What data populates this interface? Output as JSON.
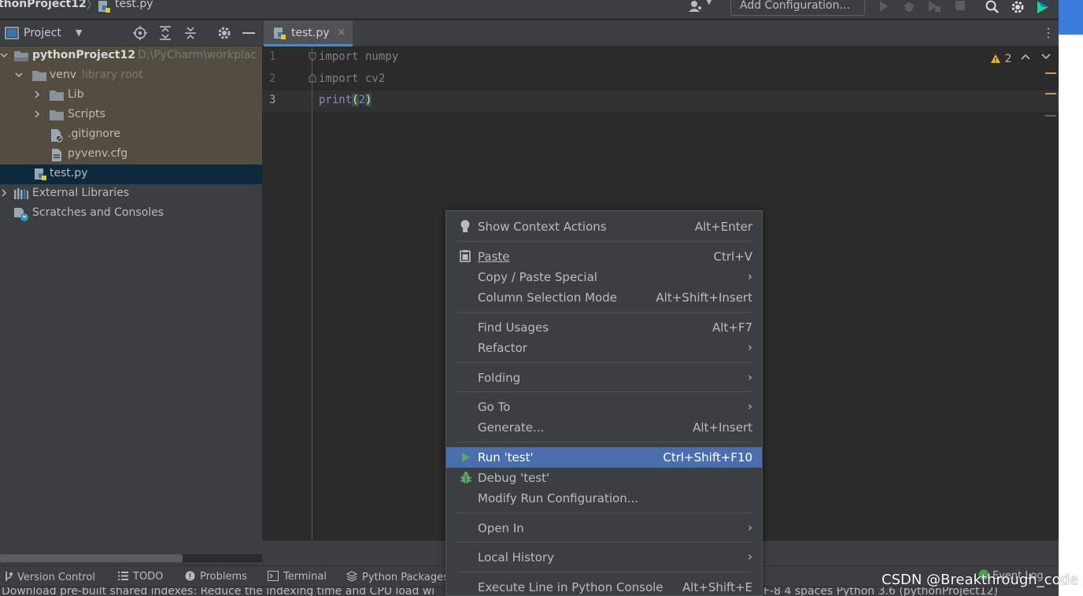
{
  "navbar": {
    "project": "thonProject12",
    "separator": "〉",
    "file": "test.py",
    "add_configuration": "Add Configuration..."
  },
  "project_panel": {
    "title": "Project",
    "tree": [
      {
        "label": "pythonProject12",
        "sub": "D:\\PyCharm\\workplac"
      },
      {
        "label": "venv",
        "sub": "library root"
      },
      {
        "label": "Lib"
      },
      {
        "label": "Scripts"
      },
      {
        "label": ".gitignore"
      },
      {
        "label": "pyvenv.cfg"
      },
      {
        "label": "test.py"
      },
      {
        "label": "External Libraries"
      },
      {
        "label": "Scratches and Consoles"
      }
    ]
  },
  "editor": {
    "tab": "test.py",
    "tab_close": "×",
    "menu": "⋮",
    "line_numbers": [
      "1",
      "2",
      "3"
    ],
    "lines": {
      "l1": "import numpy",
      "l2": "import cv2",
      "l3_fn": "print",
      "l3_open": "(",
      "l3_num": "2",
      "l3_close": ")"
    },
    "warnings": "2"
  },
  "context_menu": {
    "show_context_actions": {
      "label": "Show Context Actions",
      "shortcut": "Alt+Enter"
    },
    "paste": {
      "label": "Paste",
      "shortcut": "Ctrl+V"
    },
    "copy_paste_special": {
      "label": "Copy / Paste Special"
    },
    "column_selection_mode": {
      "label": "Column Selection Mode",
      "shortcut": "Alt+Shift+Insert"
    },
    "find_usages": {
      "label": "Find Usages",
      "shortcut": "Alt+F7"
    },
    "refactor": {
      "label": "Refactor"
    },
    "folding": {
      "label": "Folding"
    },
    "go_to": {
      "label": "Go To"
    },
    "generate": {
      "label": "Generate...",
      "shortcut": "Alt+Insert"
    },
    "run": {
      "label": "Run 'test'",
      "shortcut": "Ctrl+Shift+F10"
    },
    "debug": {
      "label": "Debug 'test'"
    },
    "modify_run": {
      "label": "Modify Run Configuration..."
    },
    "open_in": {
      "label": "Open In"
    },
    "local_history": {
      "label": "Local History"
    },
    "execute_line": {
      "label": "Execute Line in Python Console",
      "shortcut": "Alt+Shift+E"
    },
    "chevron": "›"
  },
  "tool_windows": {
    "version_control": "Version Control",
    "todo": "TODO",
    "problems": "Problems",
    "terminal": "Terminal",
    "python_packages": "Python Packages",
    "event_log": "Event Log"
  },
  "status_bar": {
    "message": "Download pre-built shared indexes: Reduce the indexing time and CPU load wi",
    "right": "F-8   4 spaces   Python 3.6 (pythonProject12)"
  },
  "watermark": "CSDN @Breakthrough_code",
  "colors": {
    "accent": "#4b6eaf",
    "tab_underline": "#4a88c7",
    "venv_highlight": "#524d40",
    "selection": "#0d293e",
    "run_green": "#499c54"
  }
}
